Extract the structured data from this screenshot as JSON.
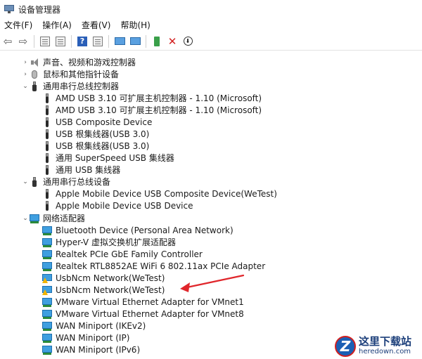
{
  "window": {
    "title": "设备管理器"
  },
  "menu": [
    "文件(F)",
    "操作(A)",
    "查看(V)",
    "帮助(H)"
  ],
  "toolbar": {
    "icons": [
      "back-icon",
      "forward-icon",
      "console-tree-icon",
      "properties-icon",
      "help-icon",
      "view-icon",
      "update-driver-icon",
      "scan-hardware-icon",
      "enable-device-icon",
      "uninstall-icon",
      "download-icon"
    ],
    "help_glyph": "?",
    "uninstall_glyph": "✕",
    "download_glyph": "⬇"
  },
  "tree": {
    "audio": {
      "label": "声音、视频和游戏控制器",
      "toggle": "›"
    },
    "mouse": {
      "label": "鼠标和其他指针设备",
      "toggle": "›"
    },
    "usb_controllers": {
      "label": "通用串行总线控制器",
      "toggle": "⌄",
      "children": [
        "AMD USB 3.10 可扩展主机控制器 - 1.10 (Microsoft)",
        "AMD USB 3.10 可扩展主机控制器 - 1.10 (Microsoft)",
        "USB Composite Device",
        "USB 根集线器(USB 3.0)",
        "USB 根集线器(USB 3.0)",
        "通用 SuperSpeed USB 集线器",
        "通用 USB 集线器"
      ]
    },
    "usb_devices": {
      "label": "通用串行总线设备",
      "toggle": "⌄",
      "children": [
        "Apple Mobile Device USB Composite Device(WeTest)",
        "Apple Mobile Device USB Device"
      ]
    },
    "network": {
      "label": "网络适配器",
      "toggle": "⌄",
      "children": [
        {
          "label": "Bluetooth Device (Personal Area Network)",
          "warning": false
        },
        {
          "label": "Hyper-V 虚拟交换机扩展适配器",
          "warning": false
        },
        {
          "label": "Realtek PCIe GbE Family Controller",
          "warning": false
        },
        {
          "label": "Realtek RTL8852AE WiFi 6 802.11ax PCIe Adapter",
          "warning": false
        },
        {
          "label": "UsbNcm Network(WeTest)",
          "warning": true
        },
        {
          "label": "UsbNcm Network(WeTest)",
          "warning": true
        },
        {
          "label": "VMware Virtual Ethernet Adapter for VMnet1",
          "warning": false
        },
        {
          "label": "VMware Virtual Ethernet Adapter for VMnet8",
          "warning": false
        },
        {
          "label": "WAN Miniport (IKEv2)",
          "warning": false
        },
        {
          "label": "WAN Miniport (IP)",
          "warning": false
        },
        {
          "label": "WAN Miniport (IPv6)",
          "warning": false
        }
      ]
    }
  },
  "annotation": {
    "color": "#e0262b"
  },
  "watermark": {
    "logo_letter": "Z",
    "cn": "这里下载站",
    "en": "heredown.com"
  }
}
